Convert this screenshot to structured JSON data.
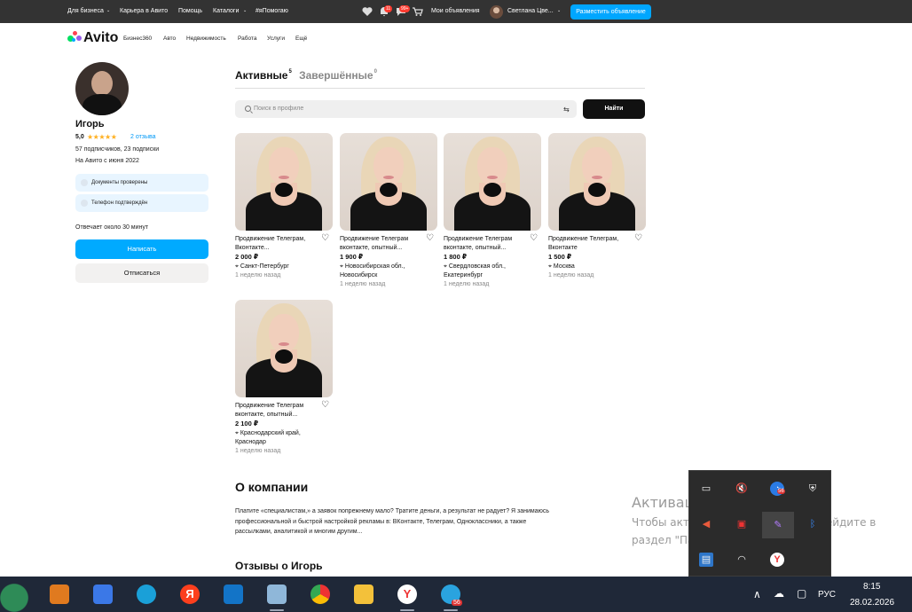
{
  "topbar": {
    "links": [
      "Для бизнеса",
      "Карьера в Авито",
      "Помощь",
      "Каталоги",
      "#яПомогаю"
    ],
    "notifications_badge": "11",
    "messages_badge": "99+",
    "my_ads": "Мои объявления",
    "user_name": "Светлана Цве...",
    "place_ad": "Разместить объявление",
    "icons": [
      "heart-icon",
      "bell-icon",
      "chat-icon",
      "cart-icon",
      "chevron-down-icon"
    ]
  },
  "nav": {
    "logo": "Avito",
    "links": [
      "Бизнес360",
      "Авто",
      "Недвижимость",
      "Работа",
      "Услуги",
      "Ещё"
    ]
  },
  "profile": {
    "name": "Игорь",
    "rating": "5,0",
    "stars": "★★★★★",
    "reviews": "2 отзыва",
    "subscribers": "57 подписчиков, 23 подписки",
    "since": "На Авито с июня 2022",
    "verified_docs": "Документы проверены",
    "verified_phone": "Телефон подтверждён",
    "response": "Отвечает около 30 минут",
    "write_btn": "Написать",
    "unsubscribe_btn": "Отписаться"
  },
  "tabs": [
    {
      "label": "Активные",
      "count": "5"
    },
    {
      "label": "Завершённые",
      "count": "0"
    }
  ],
  "search": {
    "placeholder": "Поиск в профиле",
    "button": "Найти"
  },
  "listings": [
    {
      "title": "Продвижение Телеграм, Вконтакте...",
      "price": "2 000 ₽",
      "location": "Санкт-Петербург",
      "date": "1 неделю назад"
    },
    {
      "title": "Продвижение Телеграм вконтакте, опытный...",
      "price": "1 900 ₽",
      "location": "Новосибирская обл., Новосибирск",
      "date": "1 неделю назад"
    },
    {
      "title": "Продвижение Телеграм вконтакте, опытный...",
      "price": "1 800 ₽",
      "location": "Свердловская обл., Екатеринбург",
      "date": "1 неделю назад"
    },
    {
      "title": "Продвижение Телеграм, Вконтакте",
      "price": "1 500 ₽",
      "location": "Москва",
      "date": "1 неделю назад"
    },
    {
      "title": "Продвижение Телеграм вконтакте, опытный...",
      "price": "2 100 ₽",
      "location": "Краснодарский край, Краснодар",
      "date": "1 неделю назад"
    }
  ],
  "about": {
    "title": "О компании",
    "text": "Платите «специалистам,» а заявок попрежнему мало? Тратите деньги, а результат не радует? Я занимаюсь профессиональной и быстрой настройкой рекламы в: ВКонтакте, Телеграм, Одноклассники, а также рассылками, аналитикой и многим другим..."
  },
  "reviews_title": "Отзывы о Игорь",
  "watermark": {
    "title": "Активация Windows",
    "line1": "Чтобы активировать Windows, перейдите в",
    "line2": "раздел \"Параметры\"."
  },
  "taskbar": {
    "apps": [
      "media-player-icon",
      "store-icon",
      "edge-icon",
      "yandex-icon",
      "outlook-icon",
      "notes-icon",
      "chrome-icon",
      "explorer-icon",
      "yandex-browser-icon",
      "telegram-icon"
    ],
    "telegram_badge": "56",
    "language": "РУС",
    "time": "8:15",
    "date": "28.02.2026"
  },
  "tray_popup": {
    "badge": "56"
  },
  "colors": {
    "topbar": "#333333",
    "accent": "#00aaff",
    "place_ad": "#00a6ff",
    "reviews_link": "#0099f7",
    "stars": "#ffb021",
    "taskbar": "#1f2838"
  }
}
